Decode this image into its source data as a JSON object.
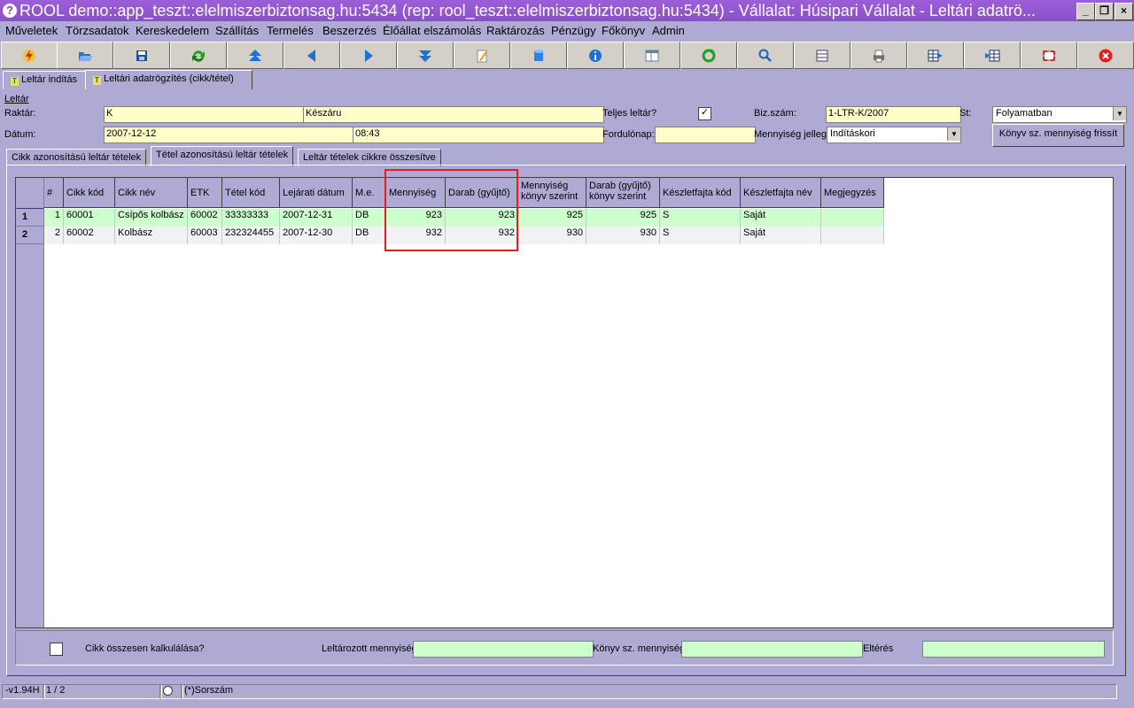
{
  "window": {
    "title": "ROOL demo::app_teszt::elelmiszerbiztonsag.hu:5434 (rep: rool_teszt::elelmiszerbiztonsag.hu:5434) - Vállalat: Húsipari Vállalat - Leltári adatrö..."
  },
  "menu": [
    "Műveletek",
    "Törzsadatok",
    "Kereskedelem",
    "Szállítás",
    "Termelés",
    "Beszerzés",
    "Élőállat elszámolás",
    "Raktározás",
    "Pénzügy",
    "Főkönyv",
    "Admin"
  ],
  "toolbar": [
    "lightning-icon",
    "open-folder-icon",
    "save-disk-icon",
    "refresh-arrow-icon",
    "first-record-icon",
    "previous-icon",
    "next-icon",
    "last-record-icon",
    "edit-pencil-icon",
    "database-icon",
    "info-icon",
    "layout-icon",
    "reload-icon",
    "search-icon",
    "list-icon",
    "print-icon",
    "grid-export-icon",
    "grid-import-icon",
    "fullscreen-icon",
    "close-icon"
  ],
  "top_tabs": [
    "Leltár indítás",
    "Leltári adatrögzítés (cikk/tétel)"
  ],
  "form": {
    "section": "Leltár",
    "raktar_label": "Raktár:",
    "raktar_code": "K",
    "raktar_name": "Készáru",
    "teljes_label": "Teljes leltár?",
    "teljes_checked": "✓",
    "bizszam_label": "Biz.szám:",
    "bizszam": "1-LTR-K/2007",
    "st_label": "St:",
    "status": "Folyamatban",
    "datum_label": "Dátum:",
    "datum": "2007-12-12",
    "ido": "08:43",
    "fordulonap_label": "Fordulónap:",
    "fordulonap": "",
    "jelleg_label": "Mennyiség jelleg:",
    "jelleg": "Indításkori",
    "refresh_button": "Könyv sz. mennyiség frissít"
  },
  "sub_tabs": [
    "Cikk azonosítású leltár tételek",
    "Tétel azonosítású leltár tételek",
    "Leltár tételek cikkre összesítve"
  ],
  "grid": {
    "headers": [
      "#",
      "Cikk kód",
      "Cikk név",
      "ETK",
      "Tétel kód",
      "Lejárati dátum",
      "M.e.",
      "Mennyiség",
      "Darab (gyűjtő)",
      "Mennyiség könyv szerint",
      "Darab (gyűjtő) könyv szerint",
      "Készletfajta kód",
      "Készletfajta név",
      "Megjegyzés"
    ],
    "row_numbers": [
      "1",
      "2"
    ],
    "rows": [
      [
        "1",
        "60001",
        "Csípős kolbász",
        "60002",
        "33333333",
        "2007-12-31",
        "DB",
        "923",
        "923",
        "925",
        "925",
        "S",
        "Saját",
        ""
      ],
      [
        "2",
        "60002",
        "Kolbász",
        "60003",
        "232324455",
        "2007-12-30",
        "DB",
        "932",
        "932",
        "930",
        "930",
        "S",
        "Saját",
        ""
      ]
    ]
  },
  "bottom": {
    "calc_label": "Cikk összesen kalkulálása?",
    "leltarozott_label": "Leltározott mennyiség",
    "konyv_label": "Könyv sz. mennyiség",
    "elteres_label": "Eltérés"
  },
  "status": {
    "version": "-v1.94H",
    "position": "1 / 2",
    "sort": "(*)Sorszám"
  },
  "colors": {
    "background": "#aeaad4",
    "field_yellow": "#ffffcc",
    "row_green": "#ccffcc",
    "highlight_red": "#e02020",
    "titlebar": "#8a4fc8"
  }
}
